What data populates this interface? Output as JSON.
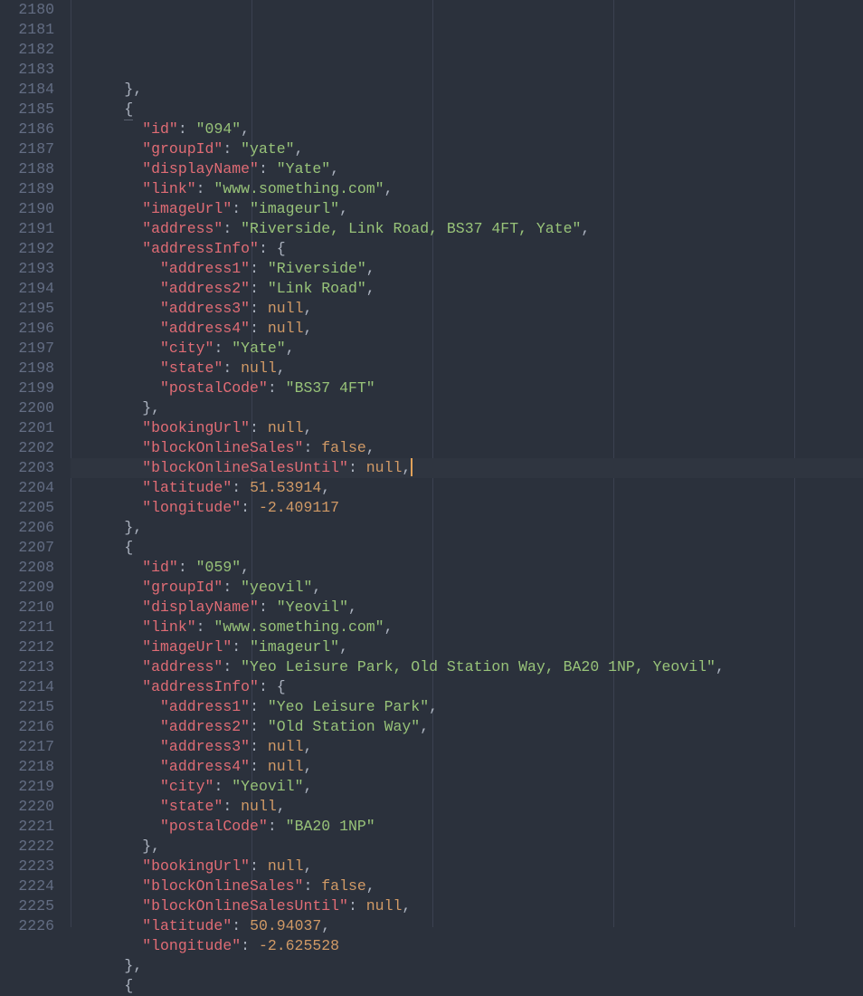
{
  "lineStart": 2180,
  "highlightLine": 2200,
  "cursorLine": 2200,
  "guides": [
    0,
    20,
    40,
    60,
    80,
    100
  ],
  "lines": [
    {
      "i": 0,
      "t": []
    },
    {
      "i": 3,
      "t": [
        {
          "p": "},"
        }
      ]
    },
    {
      "i": 3,
      "t": [
        {
          "p": "{"
        }
      ],
      "fold": true
    },
    {
      "i": 4,
      "t": [
        {
          "k": "\"id\""
        },
        {
          "p": ": "
        },
        {
          "s": "\"094\""
        },
        {
          "p": ","
        }
      ]
    },
    {
      "i": 4,
      "t": [
        {
          "k": "\"groupId\""
        },
        {
          "p": ": "
        },
        {
          "s": "\"yate\""
        },
        {
          "p": ","
        }
      ]
    },
    {
      "i": 4,
      "t": [
        {
          "k": "\"displayName\""
        },
        {
          "p": ": "
        },
        {
          "s": "\"Yate\""
        },
        {
          "p": ","
        }
      ]
    },
    {
      "i": 4,
      "t": [
        {
          "k": "\"link\""
        },
        {
          "p": ": "
        },
        {
          "s": "\"www.something.com\""
        },
        {
          "p": ","
        }
      ]
    },
    {
      "i": 4,
      "t": [
        {
          "k": "\"imageUrl\""
        },
        {
          "p": ": "
        },
        {
          "s": "\"imageurl\""
        },
        {
          "p": ","
        }
      ]
    },
    {
      "i": 4,
      "t": [
        {
          "k": "\"address\""
        },
        {
          "p": ": "
        },
        {
          "s": "\"Riverside, Link Road, BS37 4FT, Yate\""
        },
        {
          "p": ","
        }
      ]
    },
    {
      "i": 4,
      "t": [
        {
          "k": "\"addressInfo\""
        },
        {
          "p": ": {"
        }
      ]
    },
    {
      "i": 5,
      "t": [
        {
          "k": "\"address1\""
        },
        {
          "p": ": "
        },
        {
          "s": "\"Riverside\""
        },
        {
          "p": ","
        }
      ]
    },
    {
      "i": 5,
      "t": [
        {
          "k": "\"address2\""
        },
        {
          "p": ": "
        },
        {
          "s": "\"Link Road\""
        },
        {
          "p": ","
        }
      ]
    },
    {
      "i": 5,
      "t": [
        {
          "k": "\"address3\""
        },
        {
          "p": ": "
        },
        {
          "w": "null"
        },
        {
          "p": ","
        }
      ]
    },
    {
      "i": 5,
      "t": [
        {
          "k": "\"address4\""
        },
        {
          "p": ": "
        },
        {
          "w": "null"
        },
        {
          "p": ","
        }
      ]
    },
    {
      "i": 5,
      "t": [
        {
          "k": "\"city\""
        },
        {
          "p": ": "
        },
        {
          "s": "\"Yate\""
        },
        {
          "p": ","
        }
      ]
    },
    {
      "i": 5,
      "t": [
        {
          "k": "\"state\""
        },
        {
          "p": ": "
        },
        {
          "w": "null"
        },
        {
          "p": ","
        }
      ]
    },
    {
      "i": 5,
      "t": [
        {
          "k": "\"postalCode\""
        },
        {
          "p": ": "
        },
        {
          "s": "\"BS37 4FT\""
        }
      ]
    },
    {
      "i": 4,
      "t": [
        {
          "p": "},"
        }
      ]
    },
    {
      "i": 4,
      "t": [
        {
          "k": "\"bookingUrl\""
        },
        {
          "p": ": "
        },
        {
          "w": "null"
        },
        {
          "p": ","
        }
      ]
    },
    {
      "i": 4,
      "t": [
        {
          "k": "\"blockOnlineSales\""
        },
        {
          "p": ": "
        },
        {
          "w": "false"
        },
        {
          "p": ","
        }
      ]
    },
    {
      "i": 4,
      "t": [
        {
          "k": "\"blockOnlineSalesUntil\""
        },
        {
          "p": ": "
        },
        {
          "w": "null"
        },
        {
          "p": ","
        }
      ],
      "cursor": true
    },
    {
      "i": 4,
      "t": [
        {
          "k": "\"latitude\""
        },
        {
          "p": ": "
        },
        {
          "n": "51.53914"
        },
        {
          "p": ","
        }
      ]
    },
    {
      "i": 4,
      "t": [
        {
          "k": "\"longitude\""
        },
        {
          "p": ": "
        },
        {
          "n": "-2.409117"
        }
      ]
    },
    {
      "i": 3,
      "t": [
        {
          "p": "},"
        }
      ]
    },
    {
      "i": 3,
      "t": [
        {
          "p": "{"
        }
      ]
    },
    {
      "i": 4,
      "t": [
        {
          "k": "\"id\""
        },
        {
          "p": ": "
        },
        {
          "s": "\"059\""
        },
        {
          "p": ","
        }
      ]
    },
    {
      "i": 4,
      "t": [
        {
          "k": "\"groupId\""
        },
        {
          "p": ": "
        },
        {
          "s": "\"yeovil\""
        },
        {
          "p": ","
        }
      ]
    },
    {
      "i": 4,
      "t": [
        {
          "k": "\"displayName\""
        },
        {
          "p": ": "
        },
        {
          "s": "\"Yeovil\""
        },
        {
          "p": ","
        }
      ]
    },
    {
      "i": 4,
      "t": [
        {
          "k": "\"link\""
        },
        {
          "p": ": "
        },
        {
          "s": "\"www.something.com\""
        },
        {
          "p": ","
        }
      ]
    },
    {
      "i": 4,
      "t": [
        {
          "k": "\"imageUrl\""
        },
        {
          "p": ": "
        },
        {
          "s": "\"imageurl\""
        },
        {
          "p": ","
        }
      ]
    },
    {
      "i": 4,
      "t": [
        {
          "k": "\"address\""
        },
        {
          "p": ": "
        },
        {
          "s": "\"Yeo Leisure Park, Old Station Way, BA20 1NP, Yeovil\""
        },
        {
          "p": ","
        }
      ]
    },
    {
      "i": 4,
      "t": [
        {
          "k": "\"addressInfo\""
        },
        {
          "p": ": {"
        }
      ]
    },
    {
      "i": 5,
      "t": [
        {
          "k": "\"address1\""
        },
        {
          "p": ": "
        },
        {
          "s": "\"Yeo Leisure Park\""
        },
        {
          "p": ","
        }
      ]
    },
    {
      "i": 5,
      "t": [
        {
          "k": "\"address2\""
        },
        {
          "p": ": "
        },
        {
          "s": "\"Old Station Way\""
        },
        {
          "p": ","
        }
      ]
    },
    {
      "i": 5,
      "t": [
        {
          "k": "\"address3\""
        },
        {
          "p": ": "
        },
        {
          "w": "null"
        },
        {
          "p": ","
        }
      ]
    },
    {
      "i": 5,
      "t": [
        {
          "k": "\"address4\""
        },
        {
          "p": ": "
        },
        {
          "w": "null"
        },
        {
          "p": ","
        }
      ]
    },
    {
      "i": 5,
      "t": [
        {
          "k": "\"city\""
        },
        {
          "p": ": "
        },
        {
          "s": "\"Yeovil\""
        },
        {
          "p": ","
        }
      ]
    },
    {
      "i": 5,
      "t": [
        {
          "k": "\"state\""
        },
        {
          "p": ": "
        },
        {
          "w": "null"
        },
        {
          "p": ","
        }
      ]
    },
    {
      "i": 5,
      "t": [
        {
          "k": "\"postalCode\""
        },
        {
          "p": ": "
        },
        {
          "s": "\"BA20 1NP\""
        }
      ]
    },
    {
      "i": 4,
      "t": [
        {
          "p": "},"
        }
      ]
    },
    {
      "i": 4,
      "t": [
        {
          "k": "\"bookingUrl\""
        },
        {
          "p": ": "
        },
        {
          "w": "null"
        },
        {
          "p": ","
        }
      ]
    },
    {
      "i": 4,
      "t": [
        {
          "k": "\"blockOnlineSales\""
        },
        {
          "p": ": "
        },
        {
          "w": "false"
        },
        {
          "p": ","
        }
      ]
    },
    {
      "i": 4,
      "t": [
        {
          "k": "\"blockOnlineSalesUntil\""
        },
        {
          "p": ": "
        },
        {
          "w": "null"
        },
        {
          "p": ","
        }
      ]
    },
    {
      "i": 4,
      "t": [
        {
          "k": "\"latitude\""
        },
        {
          "p": ": "
        },
        {
          "n": "50.94037"
        },
        {
          "p": ","
        }
      ]
    },
    {
      "i": 4,
      "t": [
        {
          "k": "\"longitude\""
        },
        {
          "p": ": "
        },
        {
          "n": "-2.625528"
        }
      ]
    },
    {
      "i": 3,
      "t": [
        {
          "p": "},"
        }
      ]
    },
    {
      "i": 3,
      "t": [
        {
          "p": "{"
        }
      ]
    }
  ]
}
